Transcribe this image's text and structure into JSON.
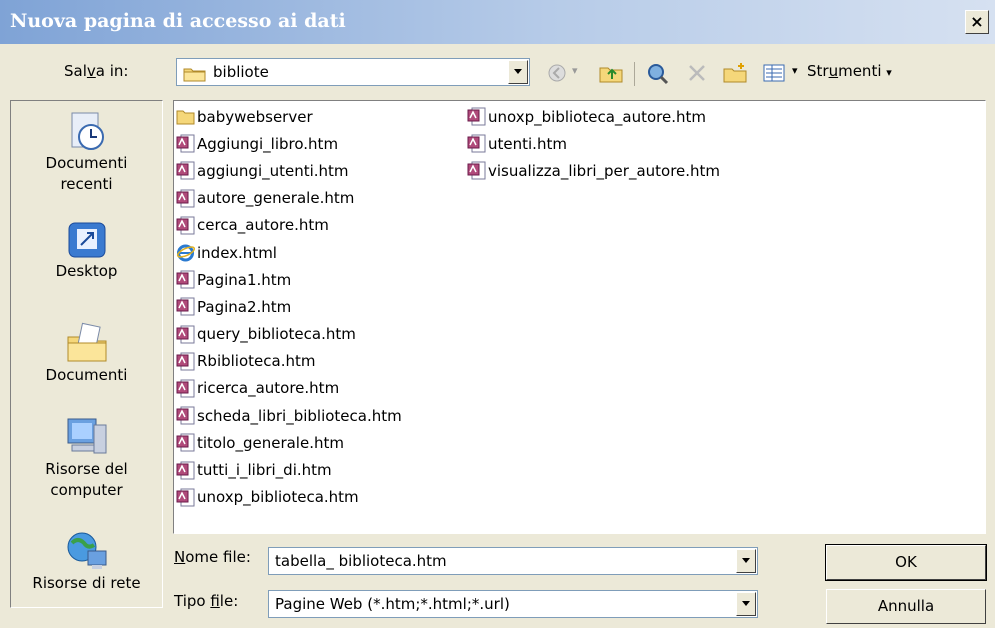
{
  "window": {
    "title": "Nuova pagina di accesso ai dati",
    "close_label": "×"
  },
  "save_in": {
    "label_pre": "Sal",
    "label_key": "v",
    "label_post": "a in:",
    "value": "bibliote"
  },
  "toolbar": {
    "icons": [
      "back-icon",
      "up-folder-icon",
      "search-web-icon",
      "delete-icon",
      "new-folder-icon",
      "views-icon"
    ],
    "tools_pre": "Str",
    "tools_key": "u",
    "tools_post": "menti"
  },
  "places": [
    {
      "label": "Documenti\nrecenti",
      "icon": "recent-documents-icon"
    },
    {
      "label": "Desktop",
      "icon": "desktop-icon"
    },
    {
      "label": "Documenti",
      "icon": "documents-icon"
    },
    {
      "label": "Risorse del\ncomputer",
      "icon": "my-computer-icon"
    },
    {
      "label": "Risorse di rete",
      "icon": "network-icon"
    }
  ],
  "files_col1": [
    {
      "name": "babywebserver",
      "type": "folder"
    },
    {
      "name": "Aggiungi_libro.htm",
      "type": "htm"
    },
    {
      "name": "aggiungi_utenti.htm",
      "type": "htm"
    },
    {
      "name": "autore_generale.htm",
      "type": "htm"
    },
    {
      "name": "cerca_autore.htm",
      "type": "htm"
    },
    {
      "name": "index.html",
      "type": "ie"
    },
    {
      "name": "Pagina1.htm",
      "type": "htm"
    },
    {
      "name": "Pagina2.htm",
      "type": "htm"
    },
    {
      "name": "query_biblioteca.htm",
      "type": "htm"
    },
    {
      "name": "Rbiblioteca.htm",
      "type": "htm"
    },
    {
      "name": "ricerca_autore.htm",
      "type": "htm"
    },
    {
      "name": "scheda_libri_biblioteca.htm",
      "type": "htm"
    },
    {
      "name": "titolo_generale.htm",
      "type": "htm"
    },
    {
      "name": "tutti_i_libri_di.htm",
      "type": "htm"
    },
    {
      "name": "unoxp_biblioteca.htm",
      "type": "htm"
    }
  ],
  "files_col2": [
    {
      "name": "unoxp_biblioteca_autore.htm",
      "type": "htm"
    },
    {
      "name": "utenti.htm",
      "type": "htm"
    },
    {
      "name": "visualizza_libri_per_autore.htm",
      "type": "htm"
    }
  ],
  "filename": {
    "label_key": "N",
    "label_post": "ome file:",
    "value": "tabella_ biblioteca.htm"
  },
  "filetype": {
    "label_pre": "Tipo ",
    "label_key": "f",
    "label_post": "ile:",
    "value": "Pagine Web (*.htm;*.html;*.url)"
  },
  "buttons": {
    "ok": "OK",
    "cancel": "Annulla"
  }
}
